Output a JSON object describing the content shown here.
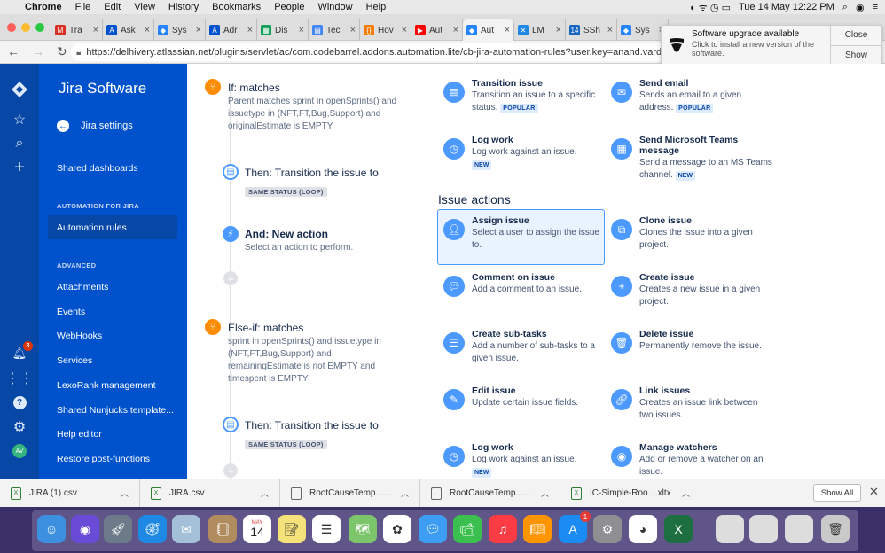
{
  "menubar": {
    "items": [
      "Chrome",
      "File",
      "Edit",
      "View",
      "History",
      "Bookmarks",
      "People",
      "Window",
      "Help"
    ],
    "datetime": "Tue 14 May  12:22 PM"
  },
  "tabs": [
    {
      "label": "Tra",
      "color": "#d93025",
      "glyph": "M"
    },
    {
      "label": "Ask",
      "color": "#0052cc",
      "glyph": "A"
    },
    {
      "label": "Sys",
      "color": "#2684ff",
      "glyph": "◆"
    },
    {
      "label": "Adr",
      "color": "#0052cc",
      "glyph": "A"
    },
    {
      "label": "Dis",
      "color": "#0f9d58",
      "glyph": "▦"
    },
    {
      "label": "Tec",
      "color": "#4285f4",
      "glyph": "▤"
    },
    {
      "label": "Hov",
      "color": "#f57c00",
      "glyph": "{}"
    },
    {
      "label": "Aut",
      "color": "#ff0000",
      "glyph": "▶"
    },
    {
      "label": "Aut",
      "color": "#2684ff",
      "glyph": "◆"
    },
    {
      "label": "LM",
      "color": "#1e88e5",
      "glyph": "✕"
    },
    {
      "label": "SSh",
      "color": "#1565c0",
      "glyph": "14"
    },
    {
      "label": "Sys",
      "color": "#2684ff",
      "glyph": "◆"
    }
  ],
  "address": {
    "url": "https://delhivery.atlassian.net/plugins/servlet/ac/com.codebarrel.addons.automation.lite/cb-jira-automation-rules?user.key=anand.vardhan&u"
  },
  "notification": {
    "title": "Software upgrade available",
    "body": "Click to install a new version of the software.",
    "close": "Close",
    "show": "Show"
  },
  "sidebar": {
    "brand": "Jira Software",
    "back": "Jira settings",
    "shared_dashboards": "Shared dashboards",
    "section1": "AUTOMATION FOR JIRA",
    "automation_rules": "Automation rules",
    "section2": "ADVANCED",
    "items": [
      "Attachments",
      "Events",
      "WebHooks",
      "Services",
      "LexoRank management",
      "Shared Nunjucks template...",
      "Help editor",
      "Restore post-functions"
    ],
    "notif_count": "3",
    "avatar": "AV"
  },
  "rule": {
    "if_title": "If: matches",
    "if_desc": "Parent matches sprint in openSprints() and issuetype in (NFT,FT,Bug,Support) and originalEstimate is EMPTY",
    "then1_title": "Then: Transition the issue to",
    "then1_tag": "SAME STATUS (LOOP)",
    "and_title": "And: New action",
    "and_desc": "Select an action to perform.",
    "elseif_title": "Else-if: matches",
    "elseif_desc": "sprint in openSprints() and issuetype in (NFT,FT,Bug,Support) and remainingEstimate is not EMPTY and timespent is EMPTY",
    "then2_title": "Then: Transition the issue to",
    "then2_tag": "SAME STATUS (LOOP)"
  },
  "actions": {
    "section_title": "Issue actions",
    "transition": {
      "title": "Transition issue",
      "desc": "Transition an issue to a specific status.",
      "badge": "POPULAR"
    },
    "send_email": {
      "title": "Send email",
      "desc": "Sends an email to a given address.",
      "badge": "POPULAR"
    },
    "log_work_top": {
      "title": "Log work",
      "desc": "Log work against an issue.",
      "badge": "NEW"
    },
    "send_teams": {
      "title": "Send Microsoft Teams message",
      "desc": "Send a message to an MS Teams channel.",
      "badge": "NEW"
    },
    "assign": {
      "title": "Assign issue",
      "desc": "Select a user to assign the issue to."
    },
    "clone": {
      "title": "Clone issue",
      "desc": "Clones the issue into a given project."
    },
    "comment": {
      "title": "Comment on issue",
      "desc": "Add a comment to an issue."
    },
    "create": {
      "title": "Create issue",
      "desc": "Creates a new issue in a given project."
    },
    "subtasks": {
      "title": "Create sub-tasks",
      "desc": "Add a number of sub-tasks to a given issue."
    },
    "delete": {
      "title": "Delete issue",
      "desc": "Permanently remove the issue."
    },
    "edit": {
      "title": "Edit issue",
      "desc": "Update certain issue fields."
    },
    "link": {
      "title": "Link issues",
      "desc": "Creates an issue link between two issues."
    },
    "log_work": {
      "title": "Log work",
      "desc": "Log work against an issue.",
      "badge": "NEW"
    },
    "watchers": {
      "title": "Manage watchers",
      "desc": "Add or remove a watcher on an issue."
    }
  },
  "downloads": {
    "items": [
      "JIRA (1).csv",
      "JIRA.csv",
      "RootCauseTemp.......",
      "RootCauseTemp.......",
      "IC-Simple-Roo....xltx"
    ],
    "show_all": "Show All"
  },
  "dock": {
    "calendar_month": "MAY",
    "calendar_day": "14",
    "appstore_badge": "1",
    "apps": [
      "finder-icon",
      "siri-icon",
      "launchpad-icon",
      "safari-icon",
      "mail-bird-icon",
      "contacts-icon",
      "calendar-icon",
      "notes-icon",
      "reminders-icon",
      "maps-icon",
      "photos-icon",
      "messages-icon",
      "facetime-icon",
      "music-icon",
      "books-icon",
      "app-store-icon",
      "system-preferences-icon",
      "chrome-icon",
      "excel-icon",
      "doc-thumb-icon",
      "doc-thumb-icon",
      "doc-thumb-icon",
      "trash-icon"
    ]
  }
}
